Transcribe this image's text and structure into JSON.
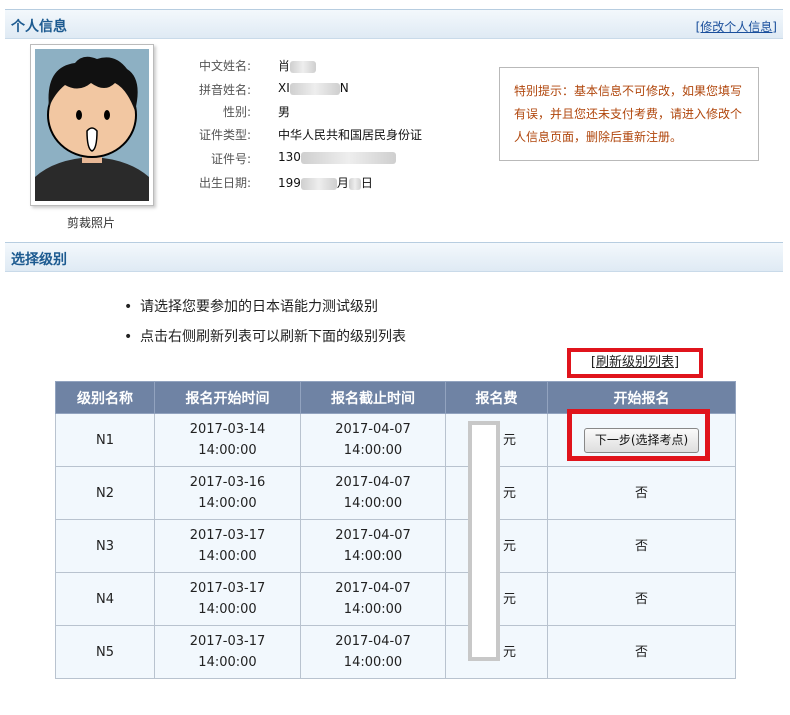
{
  "personal": {
    "title": "个人信息",
    "edit_link": "[修改个人信息]",
    "photo_caption": "剪裁照片",
    "fields": [
      {
        "label": "中文姓名:",
        "value_prefix": "肖"
      },
      {
        "label": "拼音姓名:",
        "value_prefix": "XI",
        "value_suffix": "N"
      },
      {
        "label": "性别:",
        "value": "男"
      },
      {
        "label": "证件类型:",
        "value": "中华人民共和国居民身份证"
      },
      {
        "label": "证件号:",
        "value_prefix": "130"
      },
      {
        "label": "出生日期:",
        "value_prefix": "199",
        "value_mid": "月",
        "value_suffix": "日"
      }
    ],
    "notice": "特别提示：基本信息不可修改，如果您填写有误，并且您还未支付考费，请进入修改个人信息页面，删除后重新注册。"
  },
  "level": {
    "title": "选择级别",
    "bullets": [
      "请选择您要参加的日本语能力测试级别",
      "点击右侧刷新列表可以刷新下面的级别列表"
    ],
    "bullet_marker": "•",
    "refresh_open": "[",
    "refresh_label": "刷新级别列表",
    "refresh_close": "]",
    "columns": [
      "级别名称",
      "报名开始时间",
      "报名截止时间",
      "报名费",
      "开始报名"
    ],
    "rows": [
      {
        "level": "N1",
        "start_date": "2017-03-14",
        "start_time": "14:00:00",
        "end_date": "2017-04-07",
        "end_time": "14:00:00",
        "fee_unit": "元",
        "action": "下一步(选择考点)"
      },
      {
        "level": "N2",
        "start_date": "2017-03-16",
        "start_time": "14:00:00",
        "end_date": "2017-04-07",
        "end_time": "14:00:00",
        "fee_unit": "元",
        "action": "否"
      },
      {
        "level": "N3",
        "start_date": "2017-03-17",
        "start_time": "14:00:00",
        "end_date": "2017-04-07",
        "end_time": "14:00:00",
        "fee_unit": "元",
        "action": "否"
      },
      {
        "level": "N4",
        "start_date": "2017-03-17",
        "start_time": "14:00:00",
        "end_date": "2017-04-07",
        "end_time": "14:00:00",
        "fee_unit": "元",
        "action": "否"
      },
      {
        "level": "N5",
        "start_date": "2017-03-17",
        "start_time": "14:00:00",
        "end_date": "2017-04-07",
        "end_time": "14:00:00",
        "fee_unit": "元",
        "action": "否"
      }
    ]
  },
  "colors": {
    "header_bg": "#6f83a4",
    "highlight": "#e0141c",
    "notice_text": "#b0460c",
    "section_title": "#1c5a90"
  }
}
